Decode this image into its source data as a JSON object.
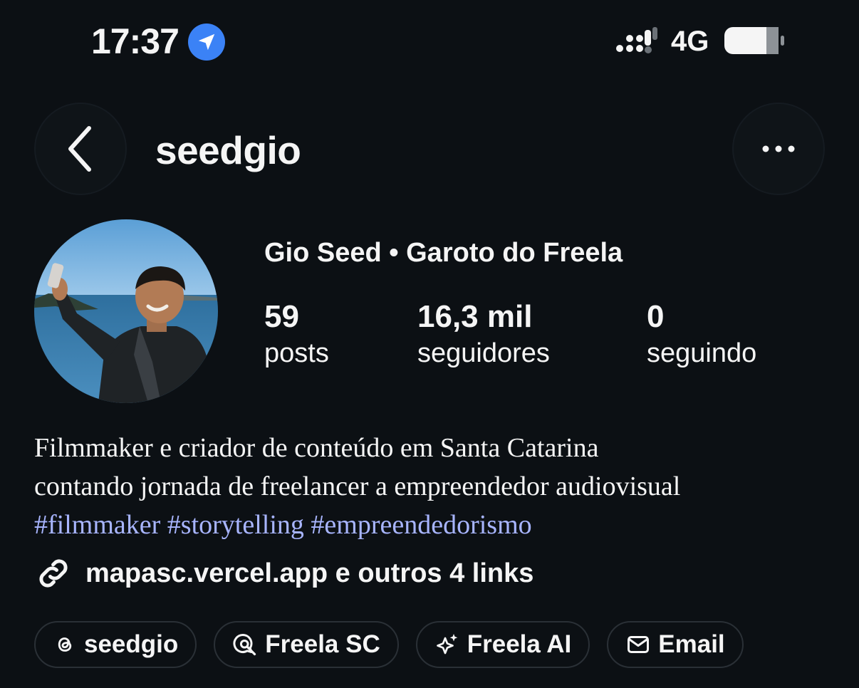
{
  "status_bar": {
    "time": "17:37",
    "network": "4G",
    "icons": [
      "location-arrow-icon",
      "signal-icon",
      "battery-icon"
    ]
  },
  "header": {
    "username": "seedgio",
    "icons": [
      "chevron-left-icon",
      "ellipsis-icon"
    ]
  },
  "profile": {
    "display_name": "Gio Seed • Garoto do Freela",
    "stats": [
      {
        "value": "59",
        "label": "posts"
      },
      {
        "value": "16,3 mil",
        "label": "seguidores"
      },
      {
        "value": "0",
        "label": "seguindo"
      }
    ],
    "bio_line1": "Filmmaker e criador de conteúdo em Santa Catarina",
    "bio_line2": "contando jornada de freelancer a empreendedor audiovisual",
    "hashtags": [
      "#filmmaker",
      "#storytelling",
      "#empreendedorismo"
    ],
    "link_text": "mapasc.vercel.app e outros 4 links"
  },
  "chips": [
    {
      "label": "seedgio",
      "icon": "threads-icon"
    },
    {
      "label": "Freela SC",
      "icon": "chat-search-icon"
    },
    {
      "label": "Freela AI",
      "icon": "sparkle-icon"
    },
    {
      "label": "Email",
      "icon": "mail-icon"
    }
  ],
  "colors": {
    "background": "#0c1014",
    "text": "#f5f5f5",
    "hashtag": "#a8b5ff",
    "location_badge": "#3b82f6",
    "chip_border": "#2a3036"
  }
}
